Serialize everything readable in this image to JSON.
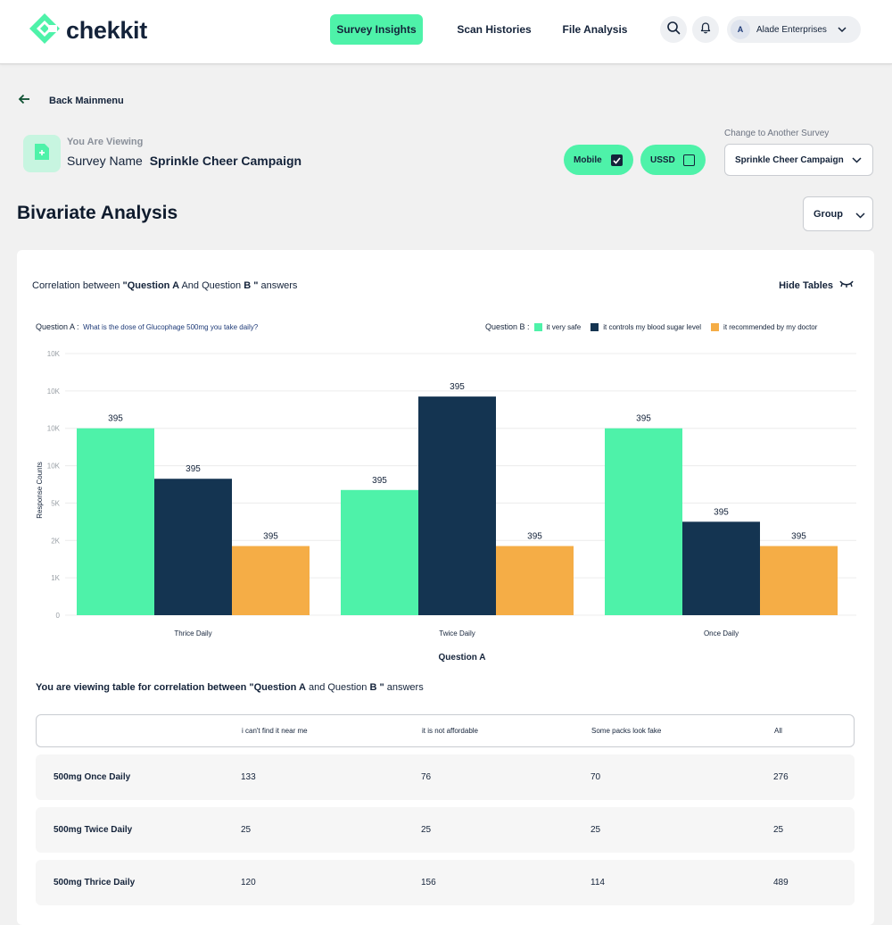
{
  "app": {
    "brand": "chekkit",
    "brand_color": "#4ef2a9",
    "nav": [
      "Survey Insights",
      "Scan Histories",
      "File Analysis"
    ],
    "active_nav": "Survey Insights",
    "org_initial": "A",
    "org_name": "Alade Enterprises",
    "icons": [
      "search-icon",
      "bell-icon",
      "chevron-down-icon"
    ]
  },
  "page": {
    "back_label": "Back Mainmenu",
    "viewing_label": "You Are Viewing",
    "survey_prefix": "Survey Name",
    "survey_name": "Sprinkle Cheer Campaign",
    "channels": [
      {
        "label": "Mobile",
        "checked": true
      },
      {
        "label": "USSD",
        "checked": false
      }
    ],
    "change_label": "Change to Another Survey",
    "survey_select_value": "Sprinkle Cheer Campaign",
    "title": "Bivariate Analysis",
    "group_select": "Group"
  },
  "analysis": {
    "corr_prefix": "Correlation between",
    "corr_q1": "\"Question ",
    "corr_a": "A",
    "corr_mid": " And Question ",
    "corr_b": "B \"",
    "corr_suffix": " answers",
    "hide_tables": "Hide Tables",
    "question_a_label": "Question A :",
    "question_a_text": "What is the dose of Glucophage 500mg you take daily?",
    "question_b_label": "Question B :"
  },
  "chart_data": {
    "type": "bar",
    "categories": [
      "Thrice Daily",
      "Twice Daily",
      "Once Daily"
    ],
    "series": [
      {
        "name": "it very safe",
        "color": "#4ef2a9",
        "values": [
          10000,
          6700,
          10000
        ],
        "labels": [
          "395",
          "395",
          "395"
        ]
      },
      {
        "name": "it controls my blood sugar level",
        "color": "#143451",
        "values": [
          7300,
          11700,
          5000
        ],
        "labels": [
          "395",
          "395",
          "395"
        ]
      },
      {
        "name": "it recommended by my doctor",
        "color": "#f5ad46",
        "values": [
          3700,
          3700,
          3700
        ],
        "labels": [
          "395",
          "395",
          "395"
        ]
      }
    ],
    "y_ticks": [
      "0",
      "1K",
      "2K",
      "5K",
      "10K",
      "10K",
      "10K",
      "10K"
    ],
    "xlabel": "Question A",
    "ylabel": "Response Counts",
    "ylim": [
      0,
      14000
    ],
    "grid": true
  },
  "table": {
    "caption_prefix": "You are viewing table for correlation between ",
    "caption_q": "\"Question ",
    "caption_a": "A",
    "caption_mid": " and Question ",
    "caption_b": "B \"",
    "caption_suffix": " answers",
    "columns": [
      "",
      "i can't find it near me",
      "it is not affordable",
      "Some packs look fake",
      "All"
    ],
    "rows": [
      [
        "500mg Once Daily",
        "133",
        "76",
        "70",
        "276"
      ],
      [
        "500mg Twice Daily",
        "25",
        "25",
        "25",
        "25"
      ],
      [
        "500mg Thrice Daily",
        "120",
        "156",
        "114",
        "489"
      ]
    ]
  }
}
